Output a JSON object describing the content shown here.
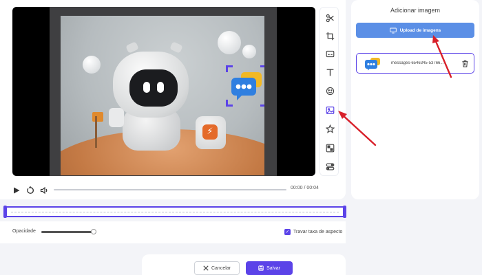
{
  "player": {
    "time": "00:00 / 00:04"
  },
  "controls": {
    "opacity_label": "Opacidade",
    "opacity_value": 0.95,
    "lock_aspect_label": "Travar taxa de aspecto",
    "lock_aspect_checked": true
  },
  "footer": {
    "cancel_label": "Cancelar",
    "save_label": "Salvar"
  },
  "right_panel": {
    "title": "Adicionar imagem",
    "upload_label": "Upload de imagens",
    "file": {
      "name": "messages-6546345-53766..."
    }
  },
  "toolbar": {
    "tools": [
      "scissors-icon",
      "crop-icon",
      "subtitle-icon",
      "text-icon",
      "emoji-icon",
      "image-icon",
      "star-icon",
      "mosaic-icon",
      "toggle-icon"
    ],
    "active": "image-icon"
  },
  "colors": {
    "accent": "#5b43e8",
    "upload": "#5b8fe6",
    "annotation_arrow": "#d8202a"
  }
}
